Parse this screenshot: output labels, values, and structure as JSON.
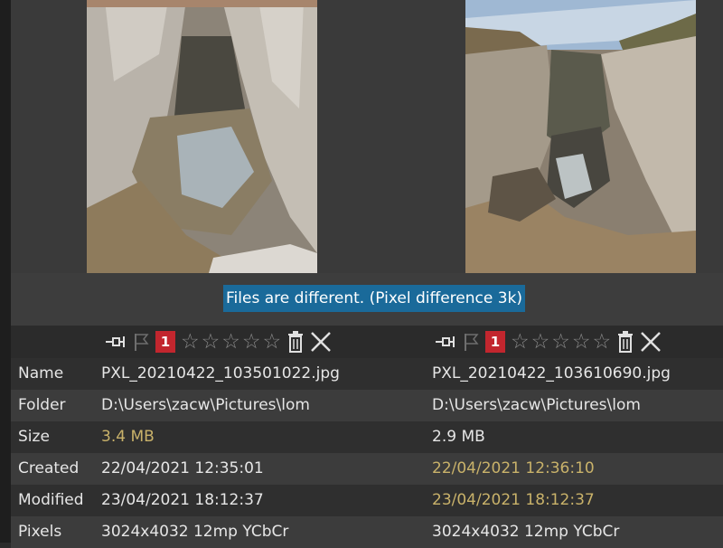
{
  "status": {
    "message": "Files are different. (Pixel difference 3k)"
  },
  "left": {
    "badge": "1",
    "rating_stars": [
      "☆",
      "☆",
      "☆",
      "☆",
      "☆"
    ],
    "name": "PXL_20210422_103501022.jpg",
    "folder": "D:\\Users\\zacw\\Pictures\\lom",
    "size": "3.4 MB",
    "created": "22/04/2021 12:35:01",
    "modified": "23/04/2021 18:12:37",
    "pixels": "3024x4032 12mp YCbCr"
  },
  "right": {
    "badge": "1",
    "rating_stars": [
      "☆",
      "☆",
      "☆",
      "☆",
      "☆"
    ],
    "name": "PXL_20210422_103610690.jpg",
    "folder": "D:\\Users\\zacw\\Pictures\\lom",
    "size": "2.9 MB",
    "created": "22/04/2021 12:36:10",
    "modified": "23/04/2021 18:12:37",
    "pixels": "3024x4032 12mp YCbCr"
  },
  "labels": {
    "name": "Name",
    "folder": "Folder",
    "size": "Size",
    "created": "Created",
    "modified": "Modified",
    "pixels": "Pixels"
  },
  "icons": {
    "pin": "pin-icon",
    "flag": "flag-icon",
    "star": "star-icon",
    "trash": "trash-icon",
    "close": "close-icon"
  },
  "colors": {
    "status_highlight": "#1a6a9a",
    "badge": "#c2262e",
    "difference_text": "#c9b26a",
    "text": "#e6e6e6"
  }
}
